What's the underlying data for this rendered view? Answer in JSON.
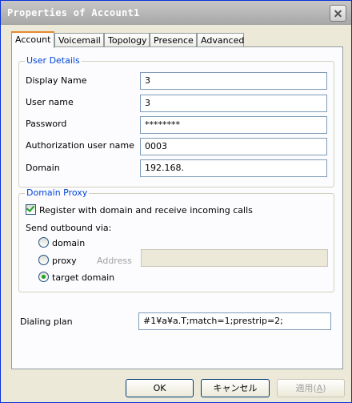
{
  "window": {
    "title": "Properties of Account1"
  },
  "tabs": [
    {
      "label": "Account",
      "selected": true
    },
    {
      "label": "Voicemail"
    },
    {
      "label": "Topology"
    },
    {
      "label": "Presence"
    },
    {
      "label": "Advanced"
    }
  ],
  "user_details": {
    "legend": "User Details",
    "display_name_label": "Display Name",
    "display_name": "3",
    "user_name_label": "User name",
    "user_name": "3",
    "password_label": "Password",
    "password": "********",
    "auth_user_label": "Authorization user name",
    "auth_user": "0003",
    "domain_label": "Domain",
    "domain": "192.168."
  },
  "domain_proxy": {
    "legend": "Domain Proxy",
    "register_label": "Register with domain and receive incoming calls",
    "register_checked": true,
    "send_outbound_label": "Send outbound via:",
    "options": [
      {
        "label": "domain",
        "selected": false
      },
      {
        "label": "proxy",
        "selected": false
      },
      {
        "label": "target domain",
        "selected": true
      }
    ],
    "address_label": "Address",
    "address": ""
  },
  "dialing_plan": {
    "label": "Dialing plan",
    "value": "#1¥a¥a.T;match=1;prestrip=2;"
  },
  "buttons": {
    "ok": "OK",
    "cancel": "キャンセル",
    "apply": "適用",
    "apply_key": "A"
  }
}
